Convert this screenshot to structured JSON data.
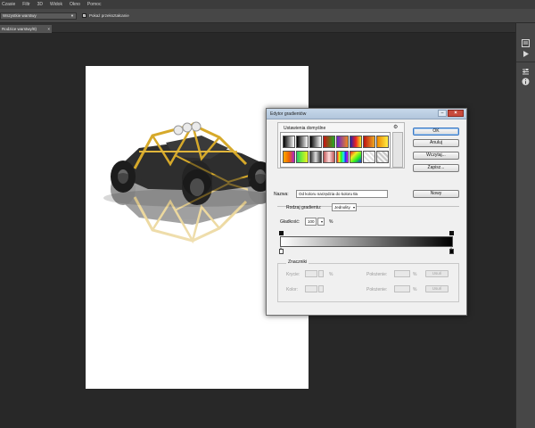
{
  "menubar": {
    "items": [
      "Czasie",
      "Filtr",
      "3D",
      "Widok",
      "Okno",
      "Pomoc"
    ]
  },
  "options": {
    "select_value": "Wszystkie warstwy",
    "checkbox_label": "Pokaż przekształcanie",
    "checkbox_checked": true
  },
  "tabs": {
    "document_tab": "Rodzice warstwy/8)",
    "close_glyph": "×"
  },
  "right_panel": {
    "icons": [
      "history-icon",
      "play-icon",
      "adjustments-icon",
      "info-icon"
    ]
  },
  "dialog": {
    "title": "Edytor gradientów",
    "presets_label": "Ustawienia domyślne",
    "buttons": {
      "ok": "OK",
      "cancel": "Anuluj",
      "load": "Wczytaj...",
      "save": "Zapisz...",
      "new": "Nowy"
    },
    "name_label": "Nazwa:",
    "name_value": "Od koloru narzędzia do koloru tła",
    "type_label": "Rodzaj gradientu:",
    "type_value": "Jednolity",
    "smoothness_label": "Gładkość:",
    "smoothness_value": "100",
    "percent": "%",
    "markers_label": "Znaczniki",
    "opacity_label": "Krycie:",
    "location_label": "Położenie:",
    "delete_label": "Usuń",
    "color_label": "Kolor:",
    "location_label2": "Położenie:",
    "delete_label2": "Usuń"
  },
  "colors": {
    "app_bg": "#282828",
    "dialog_bg": "#f0f0f0",
    "title_bar": "#b8cbe0",
    "close_button": "#c84a3c",
    "accent": "#3a78c4"
  }
}
